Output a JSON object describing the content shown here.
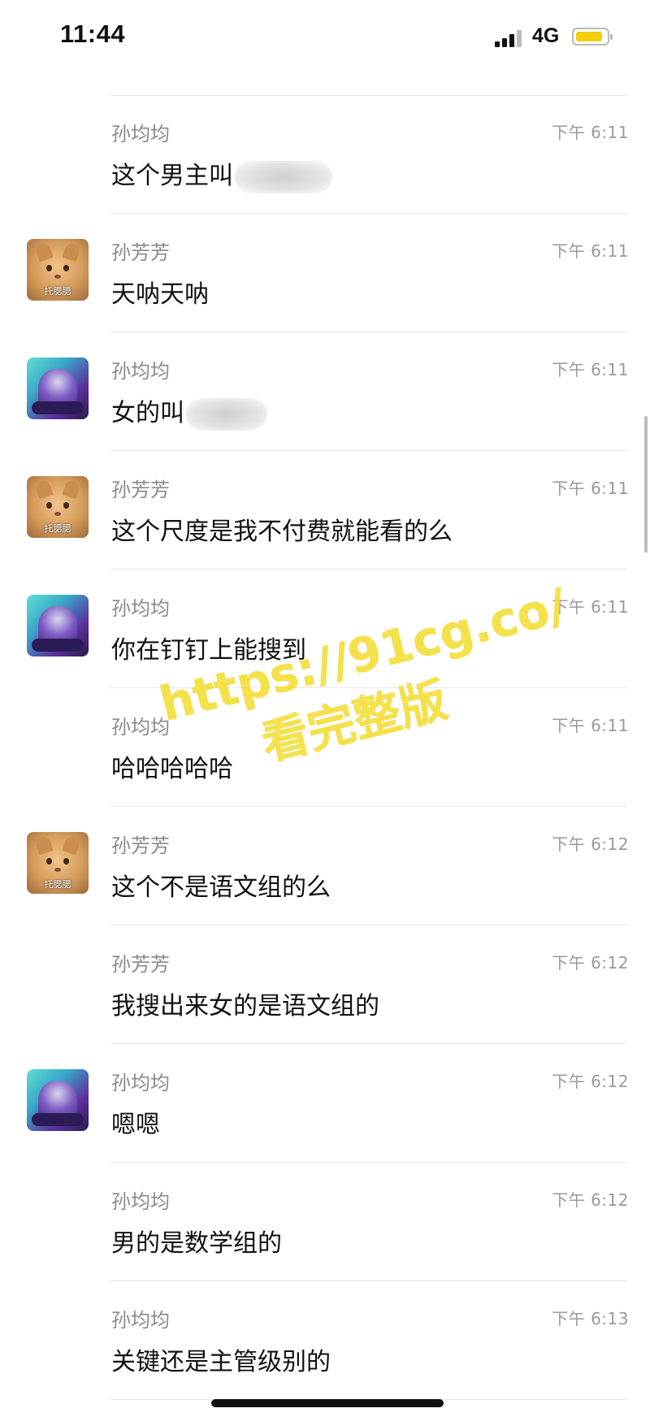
{
  "status_bar": {
    "time": "11:44",
    "network": "4G",
    "battery_color": "#f3cf09"
  },
  "messages": [
    {
      "sender": "孙均均",
      "time": "下午 6:11",
      "text": "这个男主叫",
      "avatar": "none",
      "redacted": true
    },
    {
      "sender": "孙芳芳",
      "time": "下午 6:11",
      "text": "天呐天呐",
      "avatar": "cat-avatar"
    },
    {
      "sender": "孙均均",
      "time": "下午 6:11",
      "text": "女的叫",
      "avatar": "hero-avatar",
      "redacted": true
    },
    {
      "sender": "孙芳芳",
      "time": "下午 6:11",
      "text": "这个尺度是我不付费就能看的么",
      "avatar": "cat-avatar"
    },
    {
      "sender": "孙均均",
      "time": "下午 6:11",
      "text": "你在钉钉上能搜到",
      "avatar": "hero-avatar"
    },
    {
      "sender": "孙均均",
      "time": "下午 6:11",
      "text": "哈哈哈哈哈",
      "avatar": "none"
    },
    {
      "sender": "孙芳芳",
      "time": "下午 6:12",
      "text": "这个不是语文组的么",
      "avatar": "cat-avatar"
    },
    {
      "sender": "孙芳芳",
      "time": "下午 6:12",
      "text": "我搜出来女的是语文组的",
      "avatar": "none"
    },
    {
      "sender": "孙均均",
      "time": "下午 6:12",
      "text": "嗯嗯",
      "avatar": "hero-avatar"
    },
    {
      "sender": "孙均均",
      "time": "下午 6:12",
      "text": "男的是数学组的",
      "avatar": "none"
    },
    {
      "sender": "孙均均",
      "time": "下午 6:13",
      "text": "关键还是主管级别的",
      "avatar": "none"
    }
  ],
  "avatar_caption": "托腮腮",
  "watermark": {
    "url": "https://91cg.co/",
    "subtitle": "看完整版",
    "color": "#f5de36"
  }
}
